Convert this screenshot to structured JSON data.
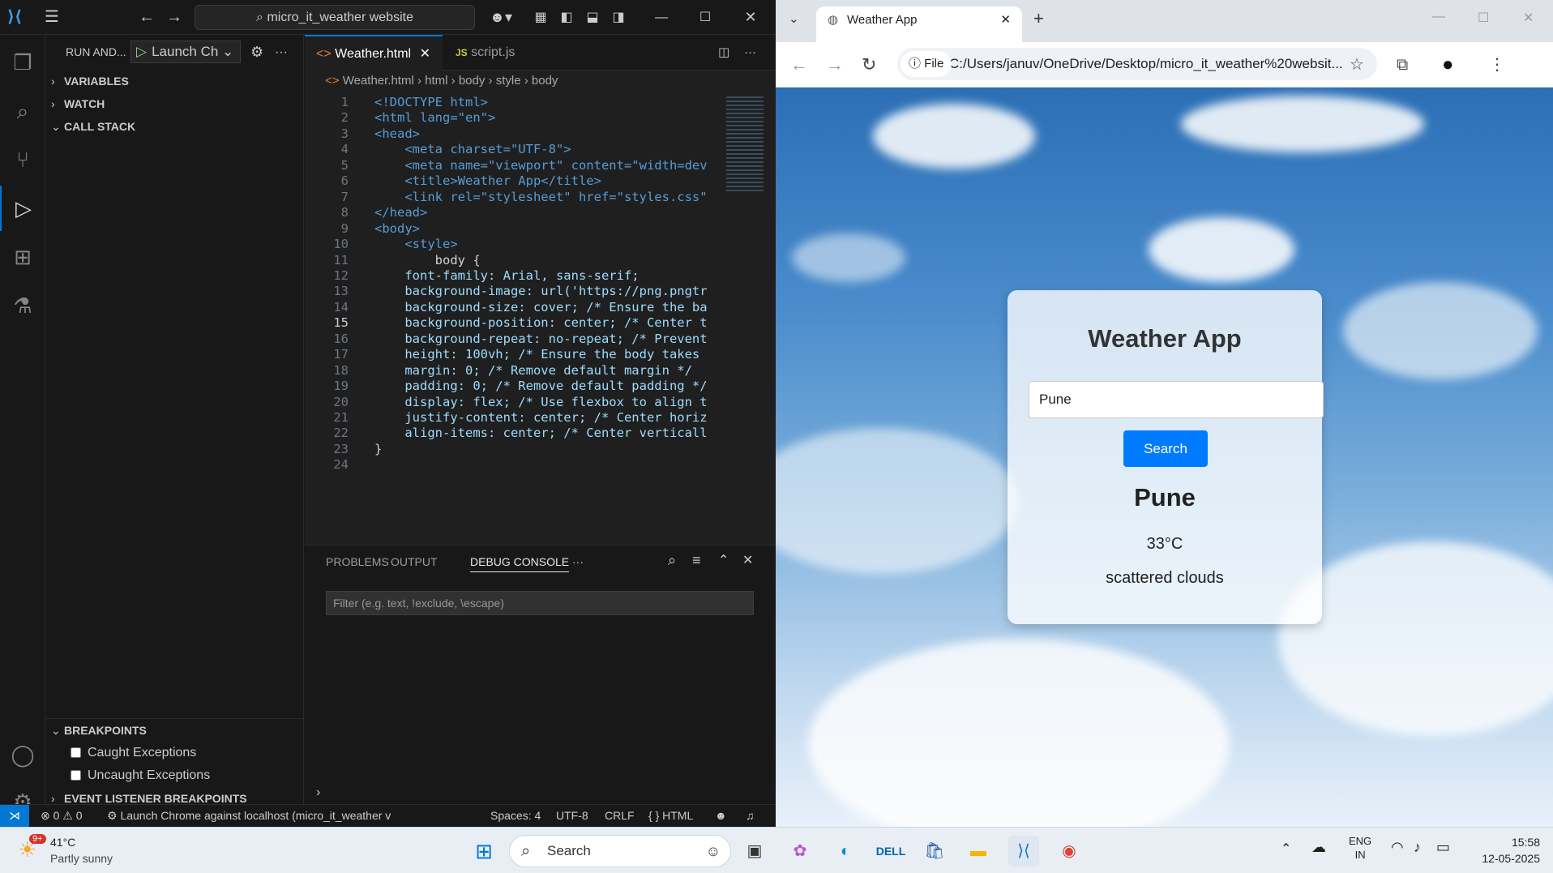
{
  "vscode": {
    "command_center": "micro_it_weather website",
    "side_title": "RUN AND...",
    "launch_config": "Launch Ch",
    "sections": {
      "variables": "VARIABLES",
      "watch": "WATCH",
      "call_stack": "CALL STACK",
      "breakpoints": "BREAKPOINTS",
      "event_listener": "EVENT LISTENER BREAKPOINTS"
    },
    "breakpoints": [
      "Caught Exceptions",
      "Uncaught Exceptions"
    ],
    "tabs": [
      "Weather.html",
      "script.js"
    ],
    "breadcrumb": [
      "Weather.html",
      "html",
      "body",
      "style",
      "body"
    ],
    "code_lines": [
      {
        "n": "1",
        "t": "<!DOCTYPE html>"
      },
      {
        "n": "2",
        "t": "<html lang=\"en\">"
      },
      {
        "n": "3",
        "t": "<head>"
      },
      {
        "n": "4",
        "t": "    <meta charset=\"UTF-8\">"
      },
      {
        "n": "5",
        "t": "    <meta name=\"viewport\" content=\"width=dev"
      },
      {
        "n": "6",
        "t": "    <title>Weather App</title>"
      },
      {
        "n": "7",
        "t": "    <link rel=\"stylesheet\" href=\"styles.css\""
      },
      {
        "n": "8",
        "t": "</head>"
      },
      {
        "n": "9",
        "t": "<body>"
      },
      {
        "n": "10",
        "t": "    <style>"
      },
      {
        "n": "11",
        "t": "        body {"
      },
      {
        "n": "12",
        "t": "    font-family: Arial, sans-serif;"
      },
      {
        "n": "13",
        "t": "    background-image: url('https://png.pngtr"
      },
      {
        "n": "14",
        "t": "    background-size: cover; /* Ensure the ba"
      },
      {
        "n": "15",
        "t": "    background-position: center; /* Center t"
      },
      {
        "n": "16",
        "t": "    background-repeat: no-repeat; /* Prevent"
      },
      {
        "n": "17",
        "t": "    height: 100vh; /* Ensure the body takes"
      },
      {
        "n": "18",
        "t": "    margin: 0; /* Remove default margin */"
      },
      {
        "n": "19",
        "t": "    padding: 0; /* Remove default padding */"
      },
      {
        "n": "20",
        "t": "    display: flex; /* Use flexbox to align t"
      },
      {
        "n": "21",
        "t": "    justify-content: center; /* Center horiz"
      },
      {
        "n": "22",
        "t": "    align-items: center; /* Center verticall"
      },
      {
        "n": "23",
        "t": "}"
      },
      {
        "n": "24",
        "t": ""
      }
    ],
    "panel_tabs": [
      "PROBLEMS",
      "OUTPUT",
      "DEBUG CONSOLE"
    ],
    "filter_placeholder": "Filter (e.g. text, !exclude, \\escape)",
    "status": {
      "errors": "0",
      "warnings": "0",
      "launch": "Launch Chrome against localhost (micro_it_weather v",
      "spaces": "Spaces: 4",
      "encoding": "UTF-8",
      "eol": "CRLF",
      "language": "{ } HTML"
    }
  },
  "browser": {
    "tab_title": "Weather App",
    "file_chip": "File",
    "url": "C:/Users/januv/OneDrive/Desktop/micro_it_weather%20websit..."
  },
  "app": {
    "title": "Weather App",
    "input_value": "Pune",
    "search_label": "Search",
    "city": "Pune",
    "temperature": "33°C",
    "description": "scattered clouds"
  },
  "taskbar": {
    "weather_temp": "41°C",
    "weather_desc": "Partly sunny",
    "badge": "9+",
    "search": "Search",
    "lang1": "ENG",
    "lang2": "IN",
    "time": "15:58",
    "date": "12-05-2025"
  }
}
